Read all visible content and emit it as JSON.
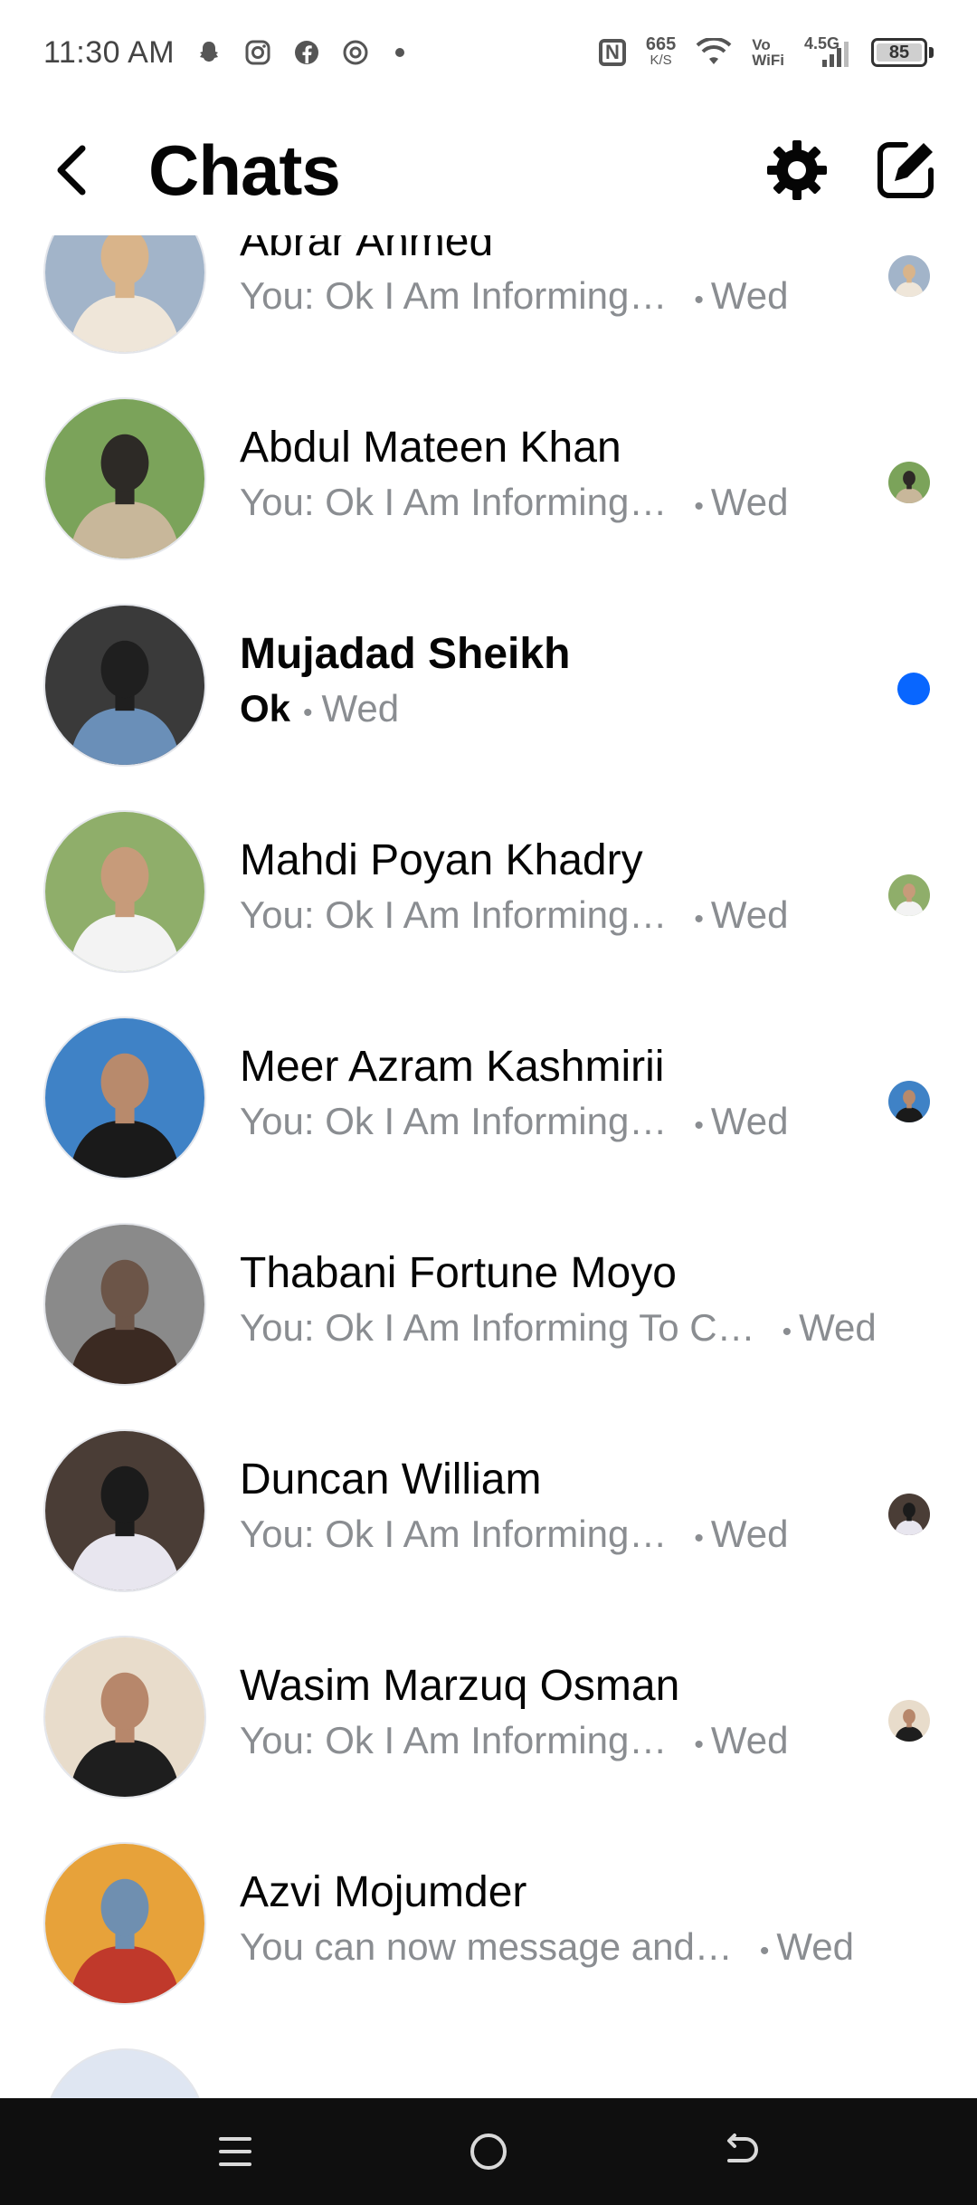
{
  "status_bar": {
    "time": "11:30 AM",
    "notification_icons": [
      "snapchat-icon",
      "instagram-icon",
      "facebook-icon",
      "vpn-icon"
    ],
    "net_speed_value": "665",
    "net_speed_unit": "K/S",
    "vowifi_line1": "Vo",
    "vowifi_line2": "WiFi",
    "network_type": "4.5G",
    "battery_level": "85"
  },
  "header": {
    "title": "Chats",
    "back_icon": "back-arrow-icon",
    "settings_icon": "gear-icon",
    "compose_icon": "compose-icon"
  },
  "chats": [
    {
      "name": "Abrar Ahmed",
      "message": "You: Ok I Am Informing…",
      "time": "Wed",
      "status": "seen",
      "colors": [
        "#a2b4c9",
        "#efe6d9",
        "#d9b48a"
      ]
    },
    {
      "name": "Abdul Mateen Khan",
      "message": "You: Ok I Am Informing…",
      "time": "Wed",
      "status": "seen",
      "colors": [
        "#7ba35a",
        "#c8b79a",
        "#2d2a26"
      ]
    },
    {
      "name": "Mujadad Sheikh",
      "message": "Ok",
      "time": "Wed",
      "status": "unread",
      "colors": [
        "#3a3a3a",
        "#6a8fb8",
        "#1f1f1f"
      ]
    },
    {
      "name": "Mahdi Poyan Khadry",
      "message": "You: Ok I Am Informing…",
      "time": "Wed",
      "status": "seen",
      "colors": [
        "#8fae6a",
        "#f3f3f3",
        "#c79b7a"
      ]
    },
    {
      "name": "Meer Azram Kashmirii",
      "message": "You: Ok I Am Informing…",
      "time": "Wed",
      "status": "seen",
      "colors": [
        "#3f82c6",
        "#1a1a1a",
        "#b88a6c"
      ]
    },
    {
      "name": "Thabani Fortune Moyo",
      "message": "You: Ok I Am Informing To C…",
      "time": "Wed",
      "status": "none",
      "colors": [
        "#8a8a8a",
        "#3b2a22",
        "#6c5548"
      ]
    },
    {
      "name": "Duncan William",
      "message": "You: Ok I Am Informing…",
      "time": "Wed",
      "status": "seen",
      "colors": [
        "#4a3d36",
        "#e8e6ef",
        "#1b1b1b"
      ]
    },
    {
      "name": "Wasim Marzuq Osman",
      "message": "You: Ok I Am Informing…",
      "time": "Wed",
      "status": "seen",
      "colors": [
        "#e8dccb",
        "#1e1e1e",
        "#b7876b"
      ]
    },
    {
      "name": "Azvi Mojumder",
      "message": "You can now message and…",
      "time": "Wed",
      "status": "none",
      "colors": [
        "#e7a23a",
        "#c0392b",
        "#6f8fb0"
      ]
    }
  ],
  "nav_bar": {
    "menu_icon": "menu-icon",
    "home_icon": "home-circle-icon",
    "back_icon": "back-gesture-icon"
  }
}
